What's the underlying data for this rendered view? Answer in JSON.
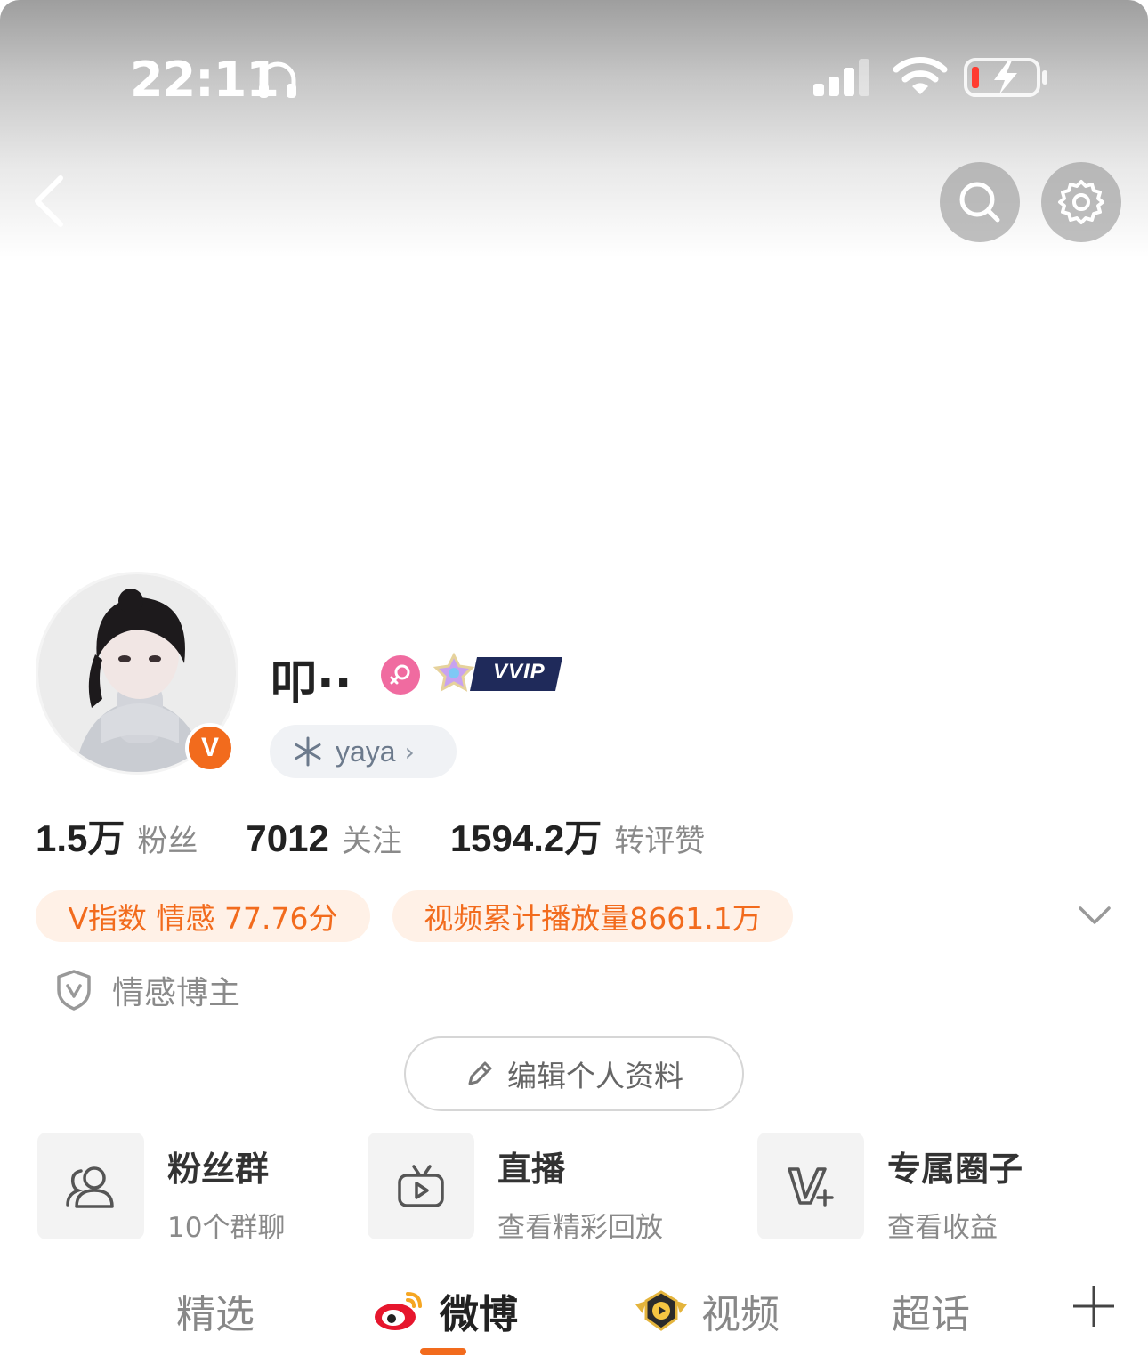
{
  "status_bar": {
    "time": "22:11",
    "icons": [
      "headphones-icon",
      "cellular-signal-icon",
      "wifi-icon",
      "battery-charging-icon"
    ],
    "battery_color": "#ff3b30"
  },
  "nav": {
    "back_icon": "chevron-left-icon",
    "search_icon": "search-icon",
    "settings_icon": "gear-icon"
  },
  "profile": {
    "name": "叩··",
    "verified_badge": "V",
    "gender_icon": "female-icon",
    "vvip_label": "VVIP",
    "fan_tag": {
      "icon": "snowflake-icon",
      "label": "yaya",
      "chevron": "›"
    }
  },
  "stats": [
    {
      "value": "1.5万",
      "label": "粉丝"
    },
    {
      "value": "7012",
      "label": "关注"
    },
    {
      "value": "1594.2万",
      "label": "转评赞"
    }
  ],
  "pills": {
    "vindex": "V指数 情感 77.76分",
    "views": "视频累计播放量8661.1万"
  },
  "category": {
    "icon": "shield-v-icon",
    "label": "情感博主"
  },
  "edit_profile": {
    "icon": "pencil-icon",
    "label": "编辑个人资料"
  },
  "features": [
    {
      "icon": "group-users-icon",
      "title": "粉丝群",
      "subtitle": "10个群聊"
    },
    {
      "icon": "tv-play-icon",
      "title": "直播",
      "subtitle": "查看精彩回放"
    },
    {
      "icon": "v-plus-icon",
      "title": "专属圈子",
      "subtitle": "查看收益"
    }
  ],
  "tabs": [
    {
      "label": "精选",
      "active": false
    },
    {
      "label": "微博",
      "active": true,
      "icon": "weibo-logo-icon"
    },
    {
      "label": "视频",
      "active": false,
      "icon": "video-badge-icon"
    },
    {
      "label": "超话",
      "active": false
    }
  ],
  "colors": {
    "accent": "#f26b1d",
    "pill_bg": "#fff1e7",
    "gender_pink": "#f06ba0"
  }
}
